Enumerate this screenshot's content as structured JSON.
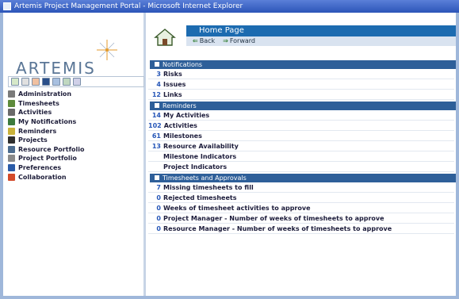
{
  "window": {
    "title": "Artemis Project Management Portal - Microsoft Internet Explorer"
  },
  "logo": {
    "text": "ARTEMIS"
  },
  "sidebar": {
    "items": [
      {
        "label": "Administration",
        "icon": "admin-icon",
        "color": "#7a7a7a"
      },
      {
        "label": "Timesheets",
        "icon": "timesheet-icon",
        "color": "#5d8a3a"
      },
      {
        "label": "Activities",
        "icon": "activities-icon",
        "color": "#6a6a6a"
      },
      {
        "label": "My Notifications",
        "icon": "notifications-icon",
        "color": "#3d7a3d"
      },
      {
        "label": "Reminders",
        "icon": "reminders-icon",
        "color": "#c9b23a"
      },
      {
        "label": "Projects",
        "icon": "projects-icon",
        "color": "#2f2f2f"
      },
      {
        "label": "Resource Portfolio",
        "icon": "resource-portfolio-icon",
        "color": "#4c6c8f"
      },
      {
        "label": "Project Portfolio",
        "icon": "project-portfolio-icon",
        "color": "#8a8a8a"
      },
      {
        "label": "Preferences",
        "icon": "preferences-icon",
        "color": "#2a5ba8"
      },
      {
        "label": "Collaboration",
        "icon": "collaboration-icon",
        "color": "#d34a2a"
      }
    ]
  },
  "header": {
    "title": "Home Page",
    "back_label": "Back",
    "forward_label": "Forward"
  },
  "sections": {
    "notifications": {
      "title": "Notifications",
      "rows": [
        {
          "count": "3",
          "label": "Risks"
        },
        {
          "count": "4",
          "label": "Issues"
        },
        {
          "count": "12",
          "label": "Links"
        }
      ]
    },
    "reminders": {
      "title": "Reminders",
      "rows": [
        {
          "count": "14",
          "label": "My Activities"
        },
        {
          "count": "102",
          "label": "Activities"
        },
        {
          "count": "61",
          "label": "Milestones"
        },
        {
          "count": "13",
          "label": "Resource Availability"
        },
        {
          "count": "",
          "label": "Milestone Indicators"
        },
        {
          "count": "",
          "label": "Project Indicators"
        }
      ]
    },
    "timesheets": {
      "title": "Timesheets and Approvals",
      "rows": [
        {
          "count": "7",
          "label": "Missing timesheets to fill"
        },
        {
          "count": "0",
          "label": "Rejected timesheets"
        },
        {
          "count": "0",
          "label": "Weeks of timesheet activities to approve"
        },
        {
          "count": "0",
          "label": "Project Manager - Number of weeks of timesheets to approve"
        },
        {
          "count": "0",
          "label": "Resource Manager - Number of weeks of timesheets to approve"
        }
      ]
    }
  },
  "colors": {
    "section_bar": "#2e5f99",
    "header_bar": "#1c6bb0",
    "count_text": "#2757b8",
    "title_bar": "#2c55b8"
  }
}
